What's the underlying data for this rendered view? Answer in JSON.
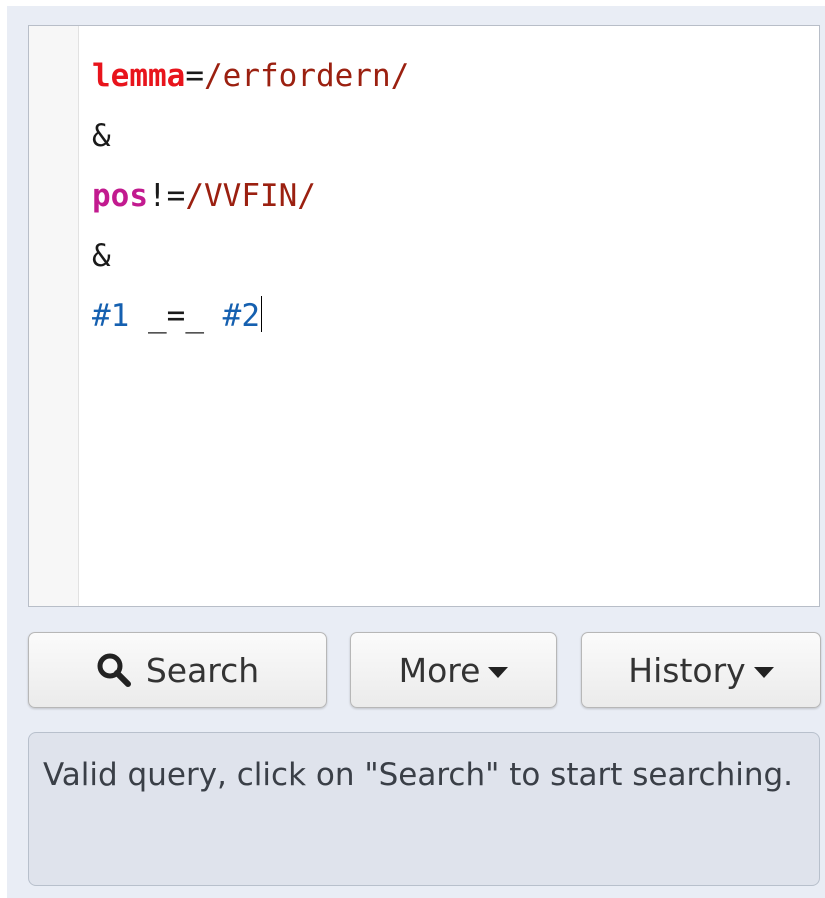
{
  "editor": {
    "lines": [
      {
        "tokens": [
          {
            "cls": "tok-kw-lemma",
            "text": "lemma"
          },
          {
            "cls": "tok-op",
            "text": "="
          },
          {
            "cls": "tok-re",
            "text": "/erfordern/"
          }
        ]
      },
      {
        "tokens": [
          {
            "cls": "tok-op",
            "text": "&"
          }
        ]
      },
      {
        "tokens": [
          {
            "cls": "tok-kw-pos",
            "text": "pos"
          },
          {
            "cls": "tok-op",
            "text": "!="
          },
          {
            "cls": "tok-re",
            "text": "/VVFIN/"
          }
        ]
      },
      {
        "tokens": [
          {
            "cls": "tok-op",
            "text": "&"
          }
        ]
      },
      {
        "tokens": [
          {
            "cls": "tok-ref",
            "text": "#1"
          },
          {
            "cls": "tok-op",
            "text": " _=_ "
          },
          {
            "cls": "tok-ref",
            "text": "#2"
          }
        ]
      }
    ]
  },
  "buttons": {
    "search_label": "Search",
    "more_label": "More",
    "history_label": "History"
  },
  "icons": {
    "search": "magnifier-icon",
    "more_caret": "caret-down-icon",
    "history_caret": "caret-down-icon"
  },
  "status": {
    "message": "Valid query, click on \"Search\" to start searching."
  }
}
